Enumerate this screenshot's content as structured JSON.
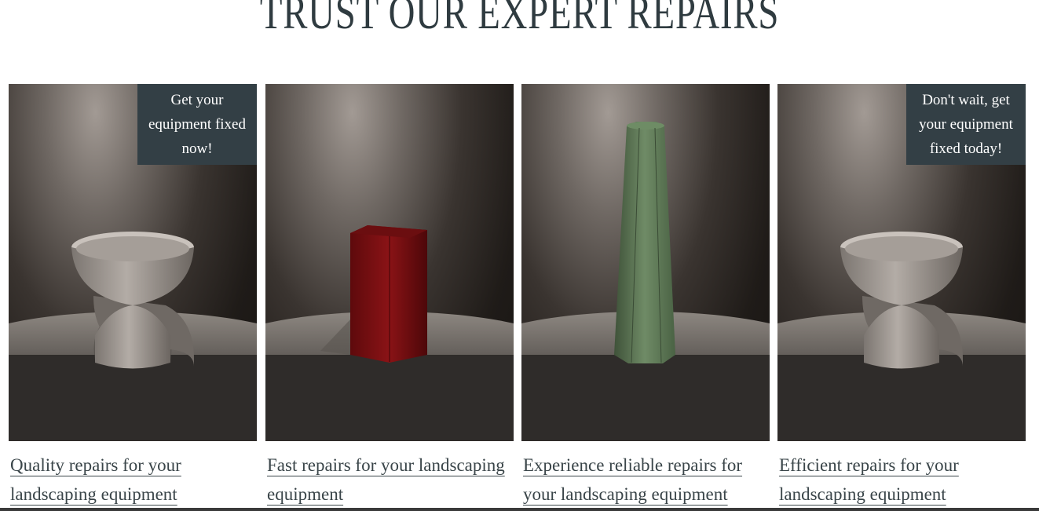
{
  "section": {
    "title": "TRUST OUR EXPERT REPAIRS"
  },
  "cards": [
    {
      "badge": "Get your equipment fixed now!",
      "caption": "Quality repairs for your landscaping equipment",
      "object": "grey-hourglass-vase"
    },
    {
      "badge": "",
      "caption": "Fast repairs for your landscaping equipment",
      "object": "red-square-vase"
    },
    {
      "badge": "",
      "caption": "Experience reliable repairs for your landscaping equipment",
      "object": "green-tall-vase"
    },
    {
      "badge": "Don't wait, get your equipment fixed today!",
      "caption": "Efficient repairs for your landscaping equipment",
      "object": "grey-hourglass-vase"
    }
  ],
  "colors": {
    "heading": "#2f3b40",
    "badge_bg": "#333f45",
    "badge_text": "#ffffff",
    "red_vase": "#7a0f12",
    "green_vase": "#5f7a58"
  }
}
